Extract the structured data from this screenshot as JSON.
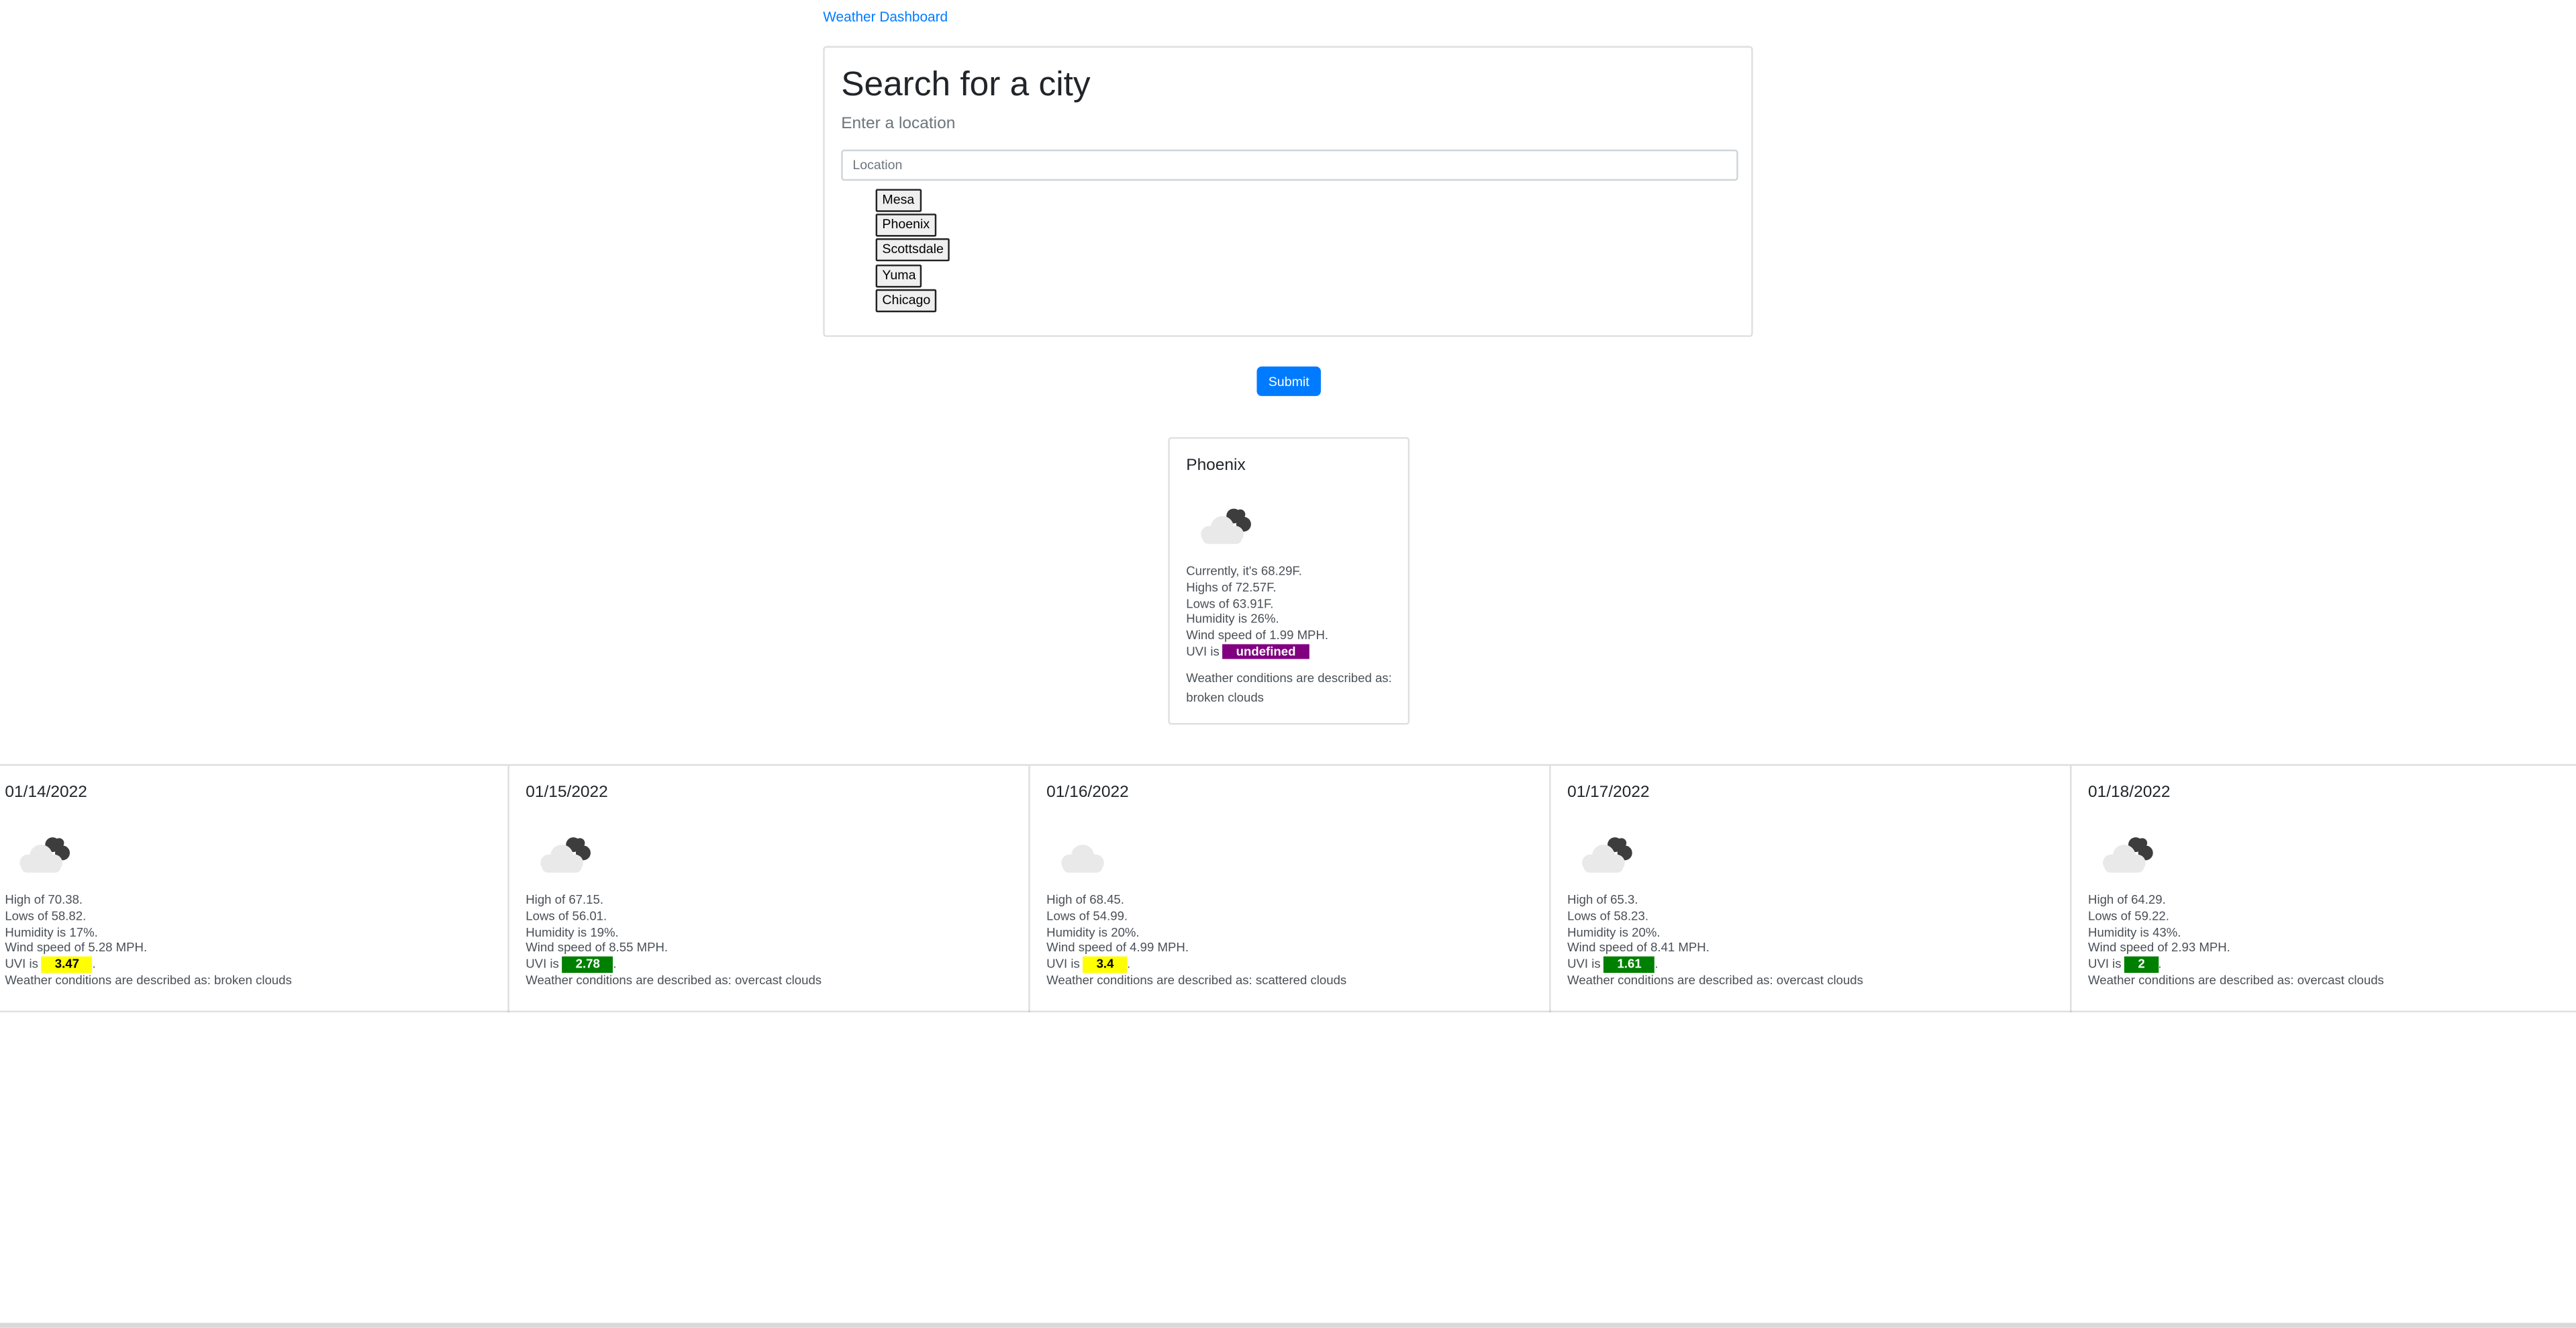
{
  "header": {
    "title": "Weather Dashboard"
  },
  "search": {
    "title": "Search for a city",
    "subtitle": "Enter a location",
    "placeholder": "Location",
    "history": [
      "Mesa",
      "Phoenix",
      "Scottsdale",
      "Yuma",
      "Chicago"
    ],
    "submit_label": "Submit"
  },
  "current": {
    "city": "Phoenix",
    "icon": "broken-clouds-icon",
    "temp_line": "Currently, it's 68.29F.",
    "high_line": "Highs of 72.57F.",
    "low_line": "Lows of 63.91F.",
    "humidity_line": "Humidity is 26%.",
    "wind_line": "Wind speed of 1.99 MPH.",
    "uvi_prefix": "UVI is",
    "uvi_value": "undefined",
    "uvi_color": "#800080",
    "description": "Weather conditions are described as: broken clouds"
  },
  "forecast": [
    {
      "date": "01/14/2022",
      "icon": "broken-clouds-icon",
      "high": "High of 70.38.",
      "low": "Lows of 58.82.",
      "humidity": "Humidity is 17%.",
      "wind": "Wind speed of 5.28 MPH.",
      "uvi_prefix": "UVI is",
      "uvi": "3.47",
      "uvi_color": "#ffff00",
      "uvi_text_color": "#000000",
      "description": "Weather conditions are described as: broken clouds"
    },
    {
      "date": "01/15/2022",
      "icon": "overcast-clouds-icon",
      "high": "High of 67.15.",
      "low": "Lows of 56.01.",
      "humidity": "Humidity is 19%.",
      "wind": "Wind speed of 8.55 MPH.",
      "uvi_prefix": "UVI is",
      "uvi": "2.78",
      "uvi_color": "#008000",
      "uvi_text_color": "#ffffff",
      "description": "Weather conditions are described as: overcast clouds"
    },
    {
      "date": "01/16/2022",
      "icon": "scattered-clouds-icon",
      "high": "High of 68.45.",
      "low": "Lows of 54.99.",
      "humidity": "Humidity is 20%.",
      "wind": "Wind speed of 4.99 MPH.",
      "uvi_prefix": "UVI is",
      "uvi": "3.4",
      "uvi_color": "#ffff00",
      "uvi_text_color": "#000000",
      "description": "Weather conditions are described as: scattered clouds"
    },
    {
      "date": "01/17/2022",
      "icon": "overcast-clouds-icon",
      "high": "High of 65.3.",
      "low": "Lows of 58.23.",
      "humidity": "Humidity is 20%.",
      "wind": "Wind speed of 8.41 MPH.",
      "uvi_prefix": "UVI is",
      "uvi": "1.61",
      "uvi_color": "#008000",
      "uvi_text_color": "#ffffff",
      "description": "Weather conditions are described as: overcast clouds"
    },
    {
      "date": "01/18/2022",
      "icon": "overcast-clouds-icon",
      "high": "High of 64.29.",
      "low": "Lows of 59.22.",
      "humidity": "Humidity is 43%.",
      "wind": "Wind speed of 2.93 MPH.",
      "uvi_prefix": "UVI is",
      "uvi": "2",
      "uvi_color": "#008000",
      "uvi_text_color": "#ffffff",
      "description": "Weather conditions are described as: overcast clouds"
    }
  ]
}
